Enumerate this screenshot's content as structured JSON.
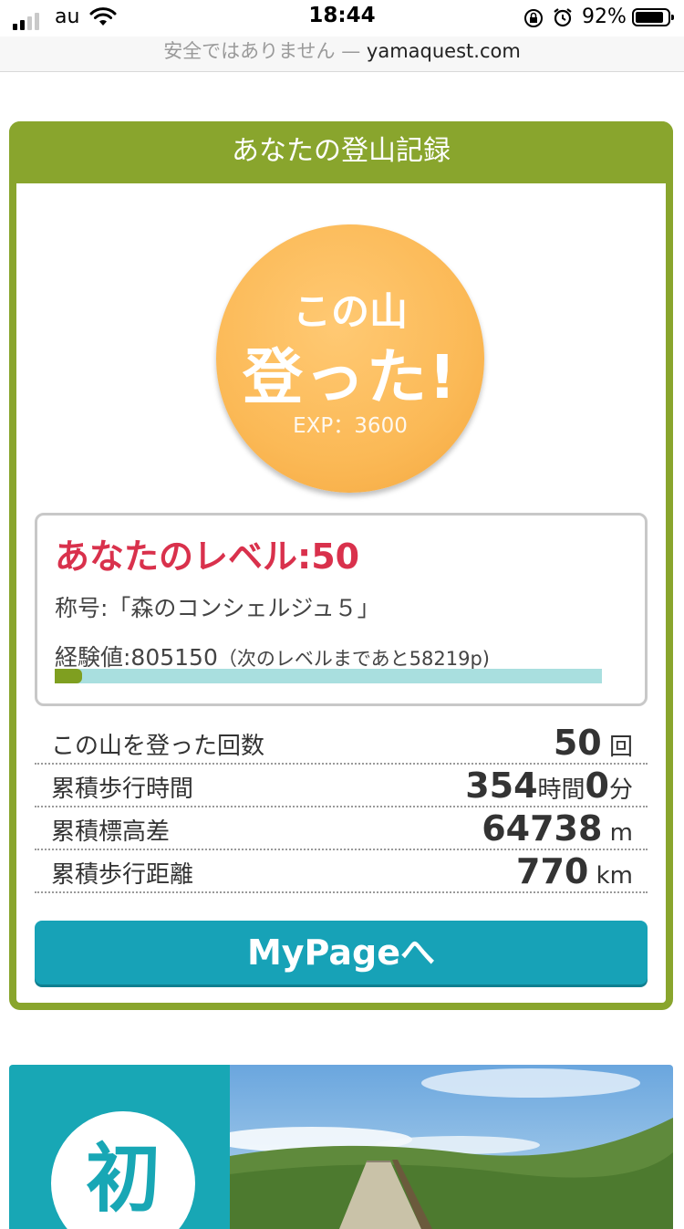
{
  "status_bar": {
    "carrier": "au",
    "time": "18:44",
    "battery": "92%"
  },
  "url_bar": {
    "security": "安全ではありません —",
    "domain": "yamaquest.com"
  },
  "record": {
    "header": "あなたの登山記録",
    "badge": {
      "line1": "この山",
      "line2": "登った!",
      "exp": "EXP：3600"
    },
    "level": {
      "title": "あなたのレベル:50",
      "rank": "称号:「森のコンシェルジュ５」",
      "exp_label": "経験値:805150",
      "exp_note": "（次のレベルまであと58219p)",
      "progress": 0.05
    },
    "stats": [
      {
        "label": "この山を登った回数",
        "parts": [
          {
            "num": "50"
          },
          {
            "unit": " 回"
          }
        ]
      },
      {
        "label": "累積歩行時間",
        "parts": [
          {
            "num": "354"
          },
          {
            "unit": "時間"
          },
          {
            "num": "0"
          },
          {
            "unit": "分"
          }
        ]
      },
      {
        "label": "累積標高差",
        "parts": [
          {
            "num": "64738"
          },
          {
            "unit": " m"
          }
        ]
      },
      {
        "label": "累積歩行距離",
        "parts": [
          {
            "num": "770"
          },
          {
            "unit": " km"
          }
        ]
      }
    ],
    "button": "MyPageへ"
  },
  "banner": {
    "char": "初"
  },
  "colors": {
    "green": "#89a52d",
    "teal": "#17a2b7",
    "level_red": "#d9314c",
    "badge_orange": "#fbb956",
    "exp_bar": "#a9dfdf"
  }
}
